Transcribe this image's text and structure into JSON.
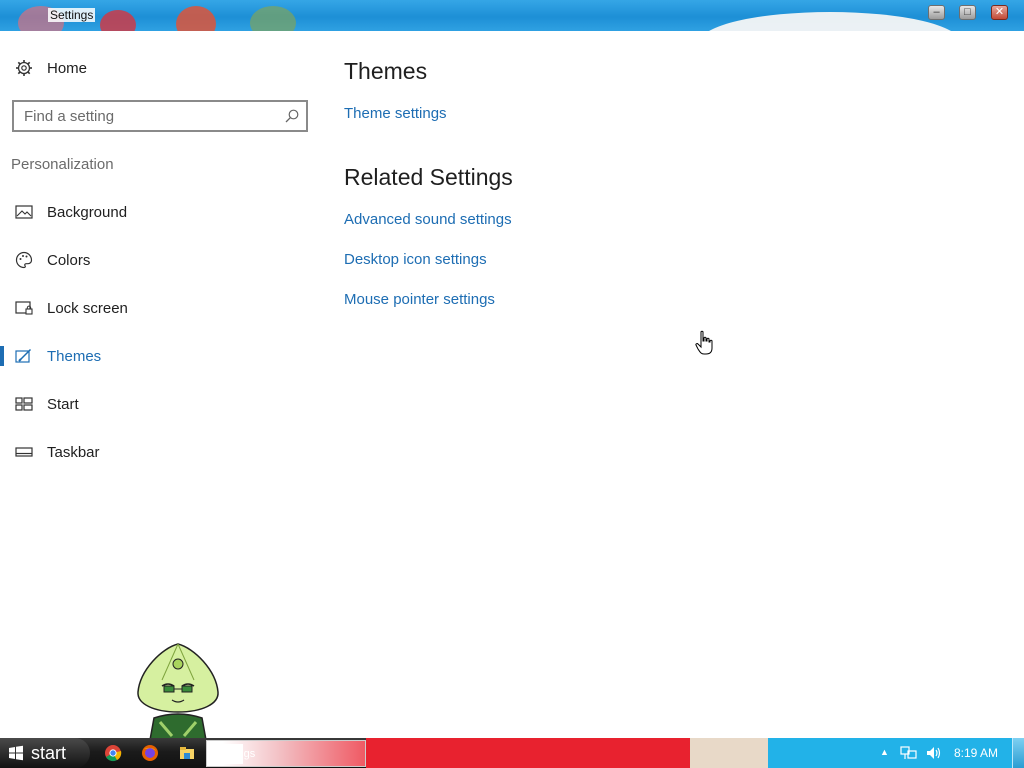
{
  "window": {
    "title": "Settings"
  },
  "nav": {
    "home_label": "Home",
    "search_placeholder": "Find a setting",
    "section_label": "Personalization",
    "items": [
      {
        "label": "Background",
        "icon": "picture-icon"
      },
      {
        "label": "Colors",
        "icon": "palette-icon"
      },
      {
        "label": "Lock screen",
        "icon": "lock-screen-icon"
      },
      {
        "label": "Themes",
        "icon": "themes-icon",
        "active": true
      },
      {
        "label": "Start",
        "icon": "start-tiles-icon"
      },
      {
        "label": "Taskbar",
        "icon": "taskbar-icon"
      }
    ]
  },
  "main": {
    "themes_heading": "Themes",
    "theme_settings_link": "Theme settings",
    "related_heading": "Related Settings",
    "related_links": [
      "Advanced sound settings",
      "Desktop icon settings",
      "Mouse pointer settings"
    ]
  },
  "taskbar": {
    "start_label": "start",
    "task_label": "ttings",
    "clock": "8:19 AM",
    "pinned": [
      "chrome-icon",
      "firefox-icon",
      "file-explorer-icon"
    ]
  },
  "colors": {
    "accent": "#1d6db3",
    "titlebar": "#1d8fd6",
    "taskbar_red": "#e8222f",
    "taskbar_blue": "#22b2e8"
  }
}
